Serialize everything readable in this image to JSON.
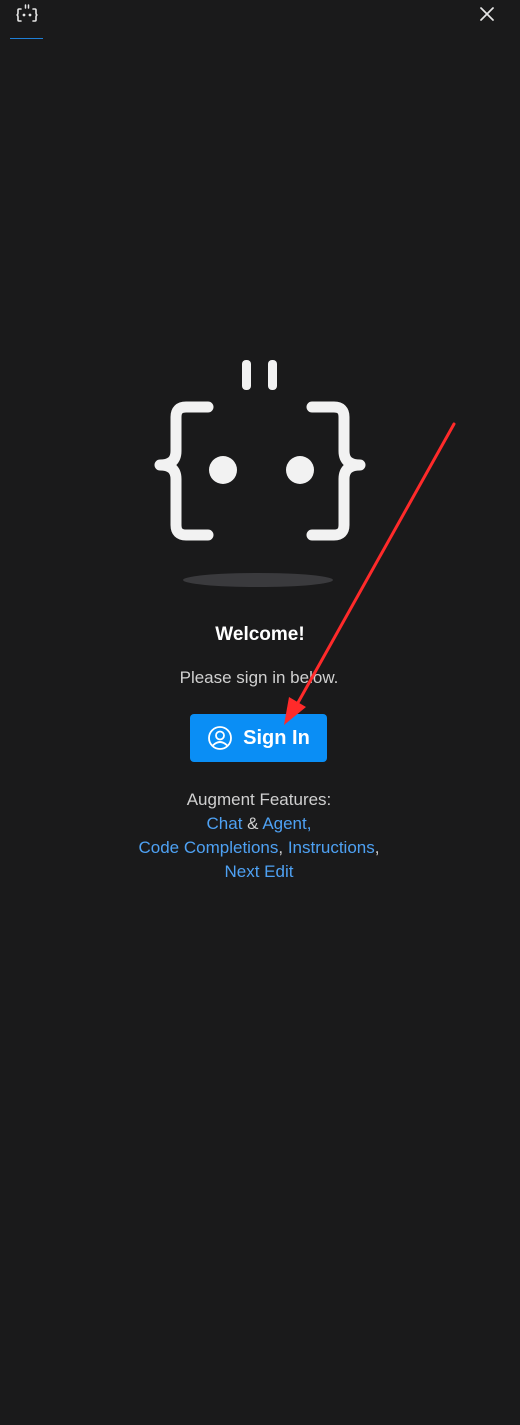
{
  "header": {
    "tab_icon": "augment-logo-icon",
    "close_icon": "close-icon"
  },
  "main": {
    "logo_icon": "augment-robot-logo-icon",
    "welcome": "Welcome!",
    "subtitle": "Please sign in below.",
    "signin_label": "Sign In",
    "signin_icon": "user-circle-icon",
    "features_heading": "Augment Features:",
    "features": {
      "chat": "Chat",
      "amp": " & ",
      "agent": "Agent,",
      "code_completions": "Code Completions",
      "comma1": ", ",
      "instructions": "Instructions",
      "comma2": ",",
      "next_edit": "Next Edit"
    }
  },
  "colors": {
    "background": "#1a1a1b",
    "accent": "#0a8ef5",
    "link": "#4ea1f3",
    "annotation_arrow": "#ff2a2a"
  }
}
